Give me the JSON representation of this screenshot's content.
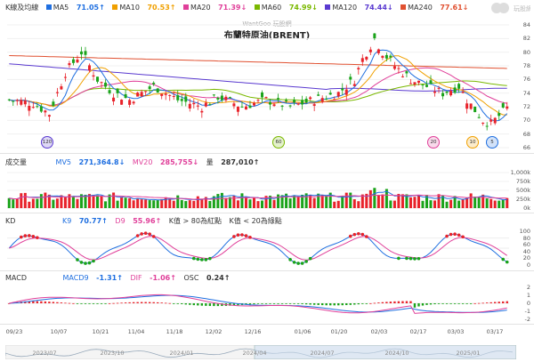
{
  "watermark": "WantGoo 玩股網",
  "logo_text": "玩股網",
  "title": "布蘭特原油(BRENT)",
  "main_legend": {
    "label": "K線及均線",
    "items": [
      {
        "name": "MA5",
        "value": "71.05↑",
        "color": "#1f6fe0"
      },
      {
        "name": "MA10",
        "value": "70.53↑",
        "color": "#f0a000"
      },
      {
        "name": "MA20",
        "value": "71.39↓",
        "color": "#e0409a"
      },
      {
        "name": "MA60",
        "value": "74.99↓",
        "color": "#7ab800"
      },
      {
        "name": "MA120",
        "value": "74.44↓",
        "color": "#5a3ad0"
      },
      {
        "name": "MA240",
        "value": "77.61↓",
        "color": "#e05030"
      }
    ]
  },
  "price_axis": [
    "84",
    "82",
    "80",
    "78",
    "76",
    "74",
    "72",
    "70",
    "68",
    "66"
  ],
  "markers": [
    {
      "label": "120",
      "color": "#5a3ad0"
    },
    {
      "label": "60",
      "color": "#7ab800"
    },
    {
      "label": "20",
      "color": "#e0409a"
    },
    {
      "label": "10",
      "color": "#f0a000"
    },
    {
      "label": "5",
      "color": "#1f6fe0"
    }
  ],
  "volume_legend": {
    "label": "成交量",
    "items": [
      {
        "name": "MV5",
        "value": "271,364.8↓",
        "color": "#1f6fe0"
      },
      {
        "name": "MV20",
        "value": "285,755↓",
        "color": "#e0409a"
      },
      {
        "name": "量",
        "value": "287,010↑",
        "color": "#333333"
      }
    ]
  },
  "volume_axis": [
    "1,000k",
    "750k",
    "500k",
    "250k",
    "0k"
  ],
  "kd_legend": {
    "label": "KD",
    "items": [
      {
        "name": "K9",
        "value": "70.77↑",
        "color": "#1f6fe0"
      },
      {
        "name": "D9",
        "value": "55.96↑",
        "color": "#e0409a"
      },
      {
        "name": "K值 > 80為紅點",
        "value": "",
        "color": "#333333"
      },
      {
        "name": "K值 < 20為綠點",
        "value": "",
        "color": "#333333"
      }
    ]
  },
  "kd_axis": [
    "100",
    "80",
    "60",
    "40",
    "20",
    "0"
  ],
  "macd_legend": {
    "label": "MACD",
    "items": [
      {
        "name": "MACD9",
        "value": "-1.31↑",
        "color": "#1f6fe0"
      },
      {
        "name": "DIF",
        "value": "-1.06↑",
        "color": "#e0409a"
      },
      {
        "name": "OSC",
        "value": "0.24↑",
        "color": "#333333"
      }
    ]
  },
  "macd_axis": [
    "2",
    "1",
    "0",
    "-1",
    "-2"
  ],
  "date_ticks": [
    "09/23",
    "10/07",
    "10/21",
    "11/04",
    "11/18",
    "12/02",
    "12/16",
    "01/06",
    "01/20",
    "02/03",
    "02/17",
    "03/03",
    "03/17"
  ],
  "nav_ticks": [
    "2023/07",
    "2023/10",
    "2024/01",
    "2024/04",
    "2024/07",
    "2024/10",
    "2025/01"
  ]
}
